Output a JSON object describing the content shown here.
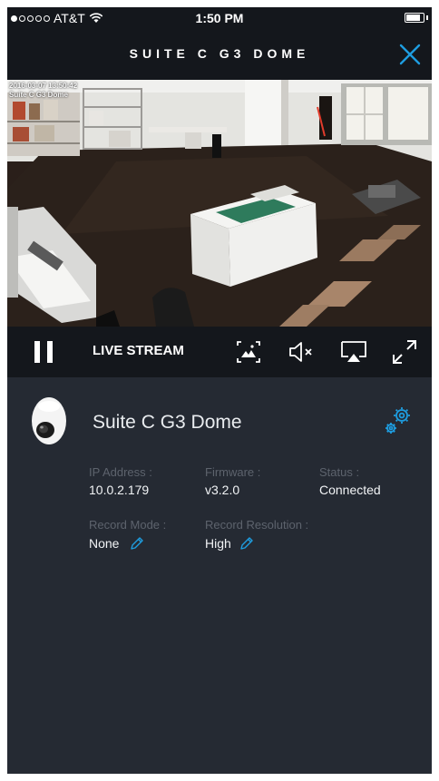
{
  "status_bar": {
    "carrier": "AT&T",
    "time": "1:50 PM",
    "signal_bars_filled": 1,
    "signal_bars_total": 5,
    "wifi_icon": "wifi-icon",
    "battery_icon": "battery-icon"
  },
  "nav": {
    "title": "SUITE C G3 DOME",
    "close_icon": "close-icon"
  },
  "video": {
    "timestamp": "2016-03-07 13:50:42",
    "camera_label": "Suite C G3 Dome"
  },
  "controls": {
    "pause_icon": "pause-icon",
    "live_label": "LIVE STREAM",
    "snapshot_icon": "snapshot-icon",
    "mute_icon": "speaker-muted-icon",
    "airplay_icon": "airplay-icon",
    "fullscreen_icon": "fullscreen-icon"
  },
  "camera": {
    "name": "Suite C G3 Dome",
    "icon": "dome-camera-icon",
    "settings_icon": "gear-icon"
  },
  "details": {
    "ip_label": "IP Address :",
    "ip_value": "10.0.2.179",
    "firmware_label": "Firmware :",
    "firmware_value": "v3.2.0",
    "status_label": "Status :",
    "status_value": "Connected",
    "record_mode_label": "Record Mode :",
    "record_mode_value": "None",
    "record_resolution_label": "Record Resolution :",
    "record_resolution_value": "High",
    "edit_icon": "pencil-icon"
  },
  "colors": {
    "accent": "#1e9de0",
    "panel_bg": "#252a33",
    "bar_bg": "#14171c",
    "label": "#5d636d",
    "value": "#f2f4f6"
  }
}
